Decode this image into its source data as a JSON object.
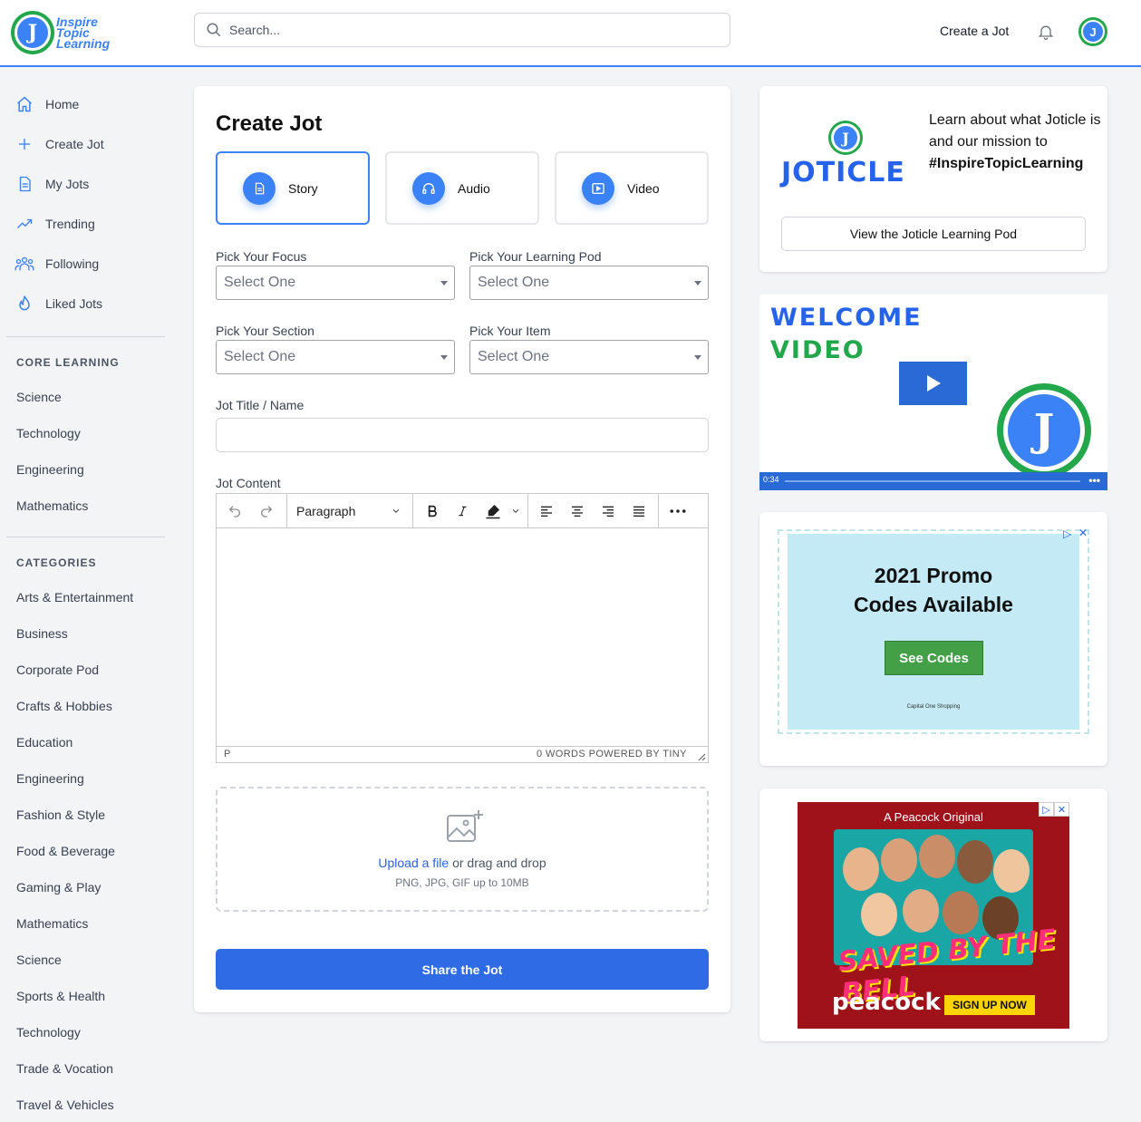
{
  "brand": {
    "logo_letter": "J",
    "logo_line1": "Inspire",
    "logo_line2": "Topic",
    "logo_line3": "Learning",
    "accent": "#3b82f6",
    "green": "#22a84a"
  },
  "header": {
    "search_placeholder": "Search...",
    "create_label": "Create a Jot"
  },
  "sidebar": {
    "nav": [
      {
        "label": "Home",
        "icon": "home-icon"
      },
      {
        "label": "Create Jot",
        "icon": "plus-icon"
      },
      {
        "label": "My Jots",
        "icon": "document-icon"
      },
      {
        "label": "Trending",
        "icon": "trending-icon"
      },
      {
        "label": "Following",
        "icon": "users-icon"
      },
      {
        "label": "Liked Jots",
        "icon": "fire-icon"
      }
    ],
    "core_title": "CORE LEARNING",
    "core": [
      "Science",
      "Technology",
      "Engineering",
      "Mathematics"
    ],
    "categories_title": "CATEGORIES",
    "categories": [
      "Arts & Entertainment",
      "Business",
      "Corporate Pod",
      "Crafts & Hobbies",
      "Education",
      "Engineering",
      "Fashion & Style",
      "Food & Beverage",
      "Gaming & Play",
      "Mathematics",
      "Science",
      "Sports & Health",
      "Technology",
      "Trade & Vocation",
      "Travel & Vehicles"
    ]
  },
  "form": {
    "title": "Create Jot",
    "types": [
      "Story",
      "Audio",
      "Video"
    ],
    "focus_label": "Pick Your Focus",
    "pod_label": "Pick Your Learning Pod",
    "section_label": "Pick Your Section",
    "item_label": "Pick Your Item",
    "select_placeholder": "Select One",
    "title_label": "Jot Title / Name",
    "content_label": "Jot Content",
    "paragraph": "Paragraph",
    "status_p": "P",
    "status_words": "0 WORDS  POWERED BY TINY",
    "upload_link": "Upload a file",
    "upload_rest": " or drag and drop",
    "upload_sub": "PNG, JPG, GIF up to 10MB",
    "share": "Share the Jot"
  },
  "joticle": {
    "logo_letter": "J",
    "word": "JOTICLE",
    "text1": "Learn about what Joticle is and our mission to",
    "text2": "#InspireTopicLearning",
    "button": "View the Joticle Learning Pod"
  },
  "video": {
    "line1": "WELCOME",
    "line2": "VIDEO",
    "logo_letter": "J",
    "time": "0:34",
    "more": "•••"
  },
  "ad1": {
    "headline1": "2021 Promo",
    "headline2": "Codes Available",
    "button": "See Codes",
    "caption": "Capital One Shopping"
  },
  "ad2": {
    "top": "A Peacock Original",
    "title": "SAVED BY THE BELL",
    "brand": "peacock",
    "button": "SIGN UP NOW"
  }
}
